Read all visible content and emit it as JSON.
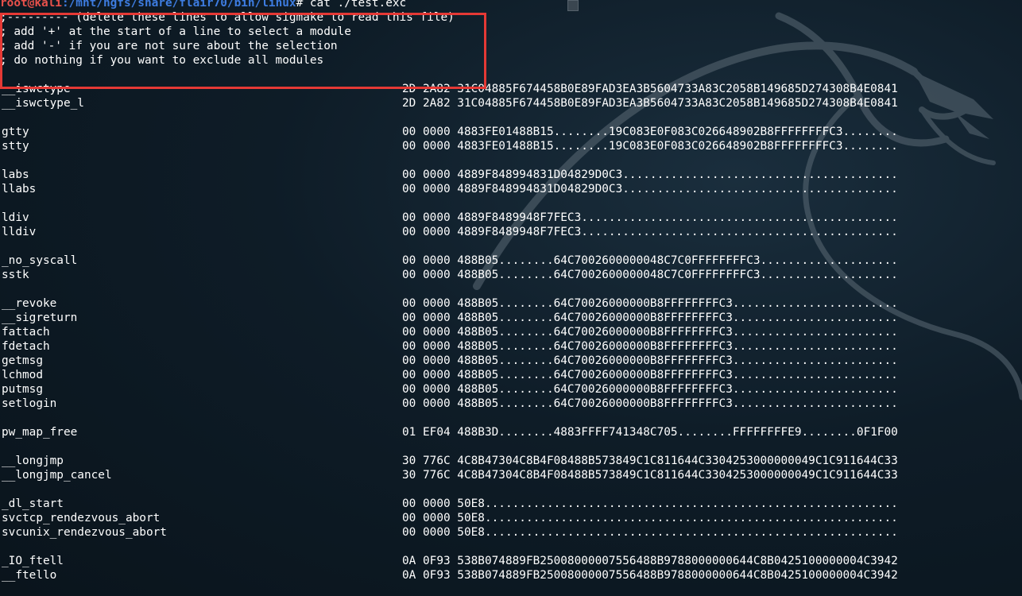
{
  "prompt": {
    "user": "root@kali",
    "path": ":/mnt/hgfs/share/flair70/bin/linux",
    "command": "# cat ./test.exc"
  },
  "header_lines": [
    ";--------- (delete these lines to allow sigmake to read this file)",
    "; add '+' at the start of a line to select a module",
    "; add '-' if you are not sure about the selection",
    "; do nothing if you want to exclude all modules"
  ],
  "entries": [
    {
      "name": "",
      "sig": ""
    },
    {
      "name": "__iswctype",
      "sig": "2D 2A82 31C04885F674458B0E89FAD3EA3B5604733A83C2058B149685D274308B4E0841"
    },
    {
      "name": "__iswctype_l",
      "sig": "2D 2A82 31C04885F674458B0E89FAD3EA3B5604733A83C2058B149685D274308B4E0841"
    },
    {
      "name": "",
      "sig": ""
    },
    {
      "name": "gtty",
      "sig": "00 0000 4883FE01488B15........19C083E0F083C026648902B8FFFFFFFFC3........"
    },
    {
      "name": "stty",
      "sig": "00 0000 4883FE01488B15........19C083E0F083C026648902B8FFFFFFFFC3........"
    },
    {
      "name": "",
      "sig": ""
    },
    {
      "name": "labs",
      "sig": "00 0000 4889F848994831D04829D0C3........................................"
    },
    {
      "name": "llabs",
      "sig": "00 0000 4889F848994831D04829D0C3........................................"
    },
    {
      "name": "",
      "sig": ""
    },
    {
      "name": "ldiv",
      "sig": "00 0000 4889F8489948F7FEC3.............................................."
    },
    {
      "name": "lldiv",
      "sig": "00 0000 4889F8489948F7FEC3.............................................."
    },
    {
      "name": "",
      "sig": ""
    },
    {
      "name": "_no_syscall",
      "sig": "00 0000 488B05........64C7002600000048C7C0FFFFFFFFC3...................."
    },
    {
      "name": "sstk",
      "sig": "00 0000 488B05........64C7002600000048C7C0FFFFFFFFC3...................."
    },
    {
      "name": "",
      "sig": ""
    },
    {
      "name": "__revoke",
      "sig": "00 0000 488B05........64C70026000000B8FFFFFFFFC3........................"
    },
    {
      "name": "__sigreturn",
      "sig": "00 0000 488B05........64C70026000000B8FFFFFFFFC3........................"
    },
    {
      "name": "fattach",
      "sig": "00 0000 488B05........64C70026000000B8FFFFFFFFC3........................"
    },
    {
      "name": "fdetach",
      "sig": "00 0000 488B05........64C70026000000B8FFFFFFFFC3........................"
    },
    {
      "name": "getmsg",
      "sig": "00 0000 488B05........64C70026000000B8FFFFFFFFC3........................"
    },
    {
      "name": "lchmod",
      "sig": "00 0000 488B05........64C70026000000B8FFFFFFFFC3........................"
    },
    {
      "name": "putmsg",
      "sig": "00 0000 488B05........64C70026000000B8FFFFFFFFC3........................"
    },
    {
      "name": "setlogin",
      "sig": "00 0000 488B05........64C70026000000B8FFFFFFFFC3........................"
    },
    {
      "name": "",
      "sig": ""
    },
    {
      "name": "pw_map_free",
      "sig": "01 EF04 488B3D........4883FFFF741348C705........FFFFFFFFE9........0F1F00"
    },
    {
      "name": "",
      "sig": ""
    },
    {
      "name": "__longjmp",
      "sig": "30 776C 4C8B47304C8B4F08488B573849C1C811644C3304253000000049C1C911644C33"
    },
    {
      "name": "__longjmp_cancel",
      "sig": "30 776C 4C8B47304C8B4F08488B573849C1C811644C3304253000000049C1C911644C33"
    },
    {
      "name": "",
      "sig": ""
    },
    {
      "name": "_dl_start",
      "sig": "00 0000 50E8............................................................"
    },
    {
      "name": "svctcp_rendezvous_abort",
      "sig": "00 0000 50E8............................................................"
    },
    {
      "name": "svcunix_rendezvous_abort",
      "sig": "00 0000 50E8............................................................"
    },
    {
      "name": "",
      "sig": ""
    },
    {
      "name": "_IO_ftell",
      "sig": "0A 0F93 538B074889FB25008000007556488B9788000000644C8B0425100000004C3942"
    },
    {
      "name": "__ftello",
      "sig": "0A 0F93 538B074889FB25008000007556488B9788000000644C8B0425100000004C3942"
    }
  ],
  "colors": {
    "prompt_user": "#e8514b",
    "prompt_path": "#3d7ce0",
    "highlight_box": "#e53935",
    "background": "#0e1c27"
  },
  "icons": {
    "background_logo": "kali-dragon-icon"
  }
}
